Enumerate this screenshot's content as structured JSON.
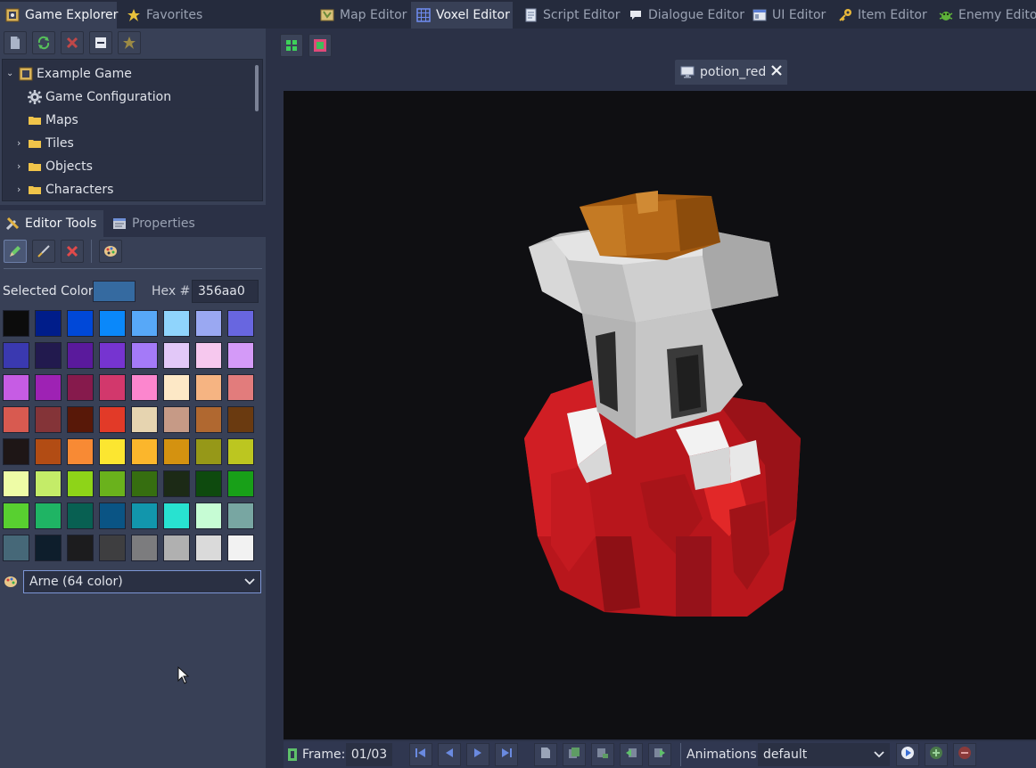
{
  "left_tabs": [
    {
      "label": "Game Explorer",
      "icon": "game-explorer-icon",
      "active": true
    },
    {
      "label": "Favorites",
      "icon": "star-icon",
      "active": false
    }
  ],
  "editor_tabs": [
    {
      "label": "Map Editor",
      "icon": "map-icon",
      "active": false
    },
    {
      "label": "Voxel Editor",
      "icon": "voxel-grid-icon",
      "active": true
    },
    {
      "label": "Script Editor",
      "icon": "script-icon",
      "active": false
    },
    {
      "label": "Dialogue Editor",
      "icon": "dialogue-icon",
      "active": false
    },
    {
      "label": "UI Editor",
      "icon": "ui-window-icon",
      "active": false
    },
    {
      "label": "Item Editor",
      "icon": "key-icon",
      "active": false
    },
    {
      "label": "Enemy Editor",
      "icon": "enemy-bug-icon",
      "active": false
    }
  ],
  "explorer_toolbar": [
    "new-file-icon",
    "refresh-icon",
    "delete-icon",
    "collapse-icon",
    "favorite-star-icon"
  ],
  "tree": [
    {
      "label": "Example Game",
      "icon": "game-icon",
      "depth": 0,
      "arrow": "down"
    },
    {
      "label": "Game Configuration",
      "icon": "gear-icon",
      "depth": 1,
      "arrow": ""
    },
    {
      "label": "Maps",
      "icon": "folder-icon",
      "depth": 1,
      "arrow": ""
    },
    {
      "label": "Tiles",
      "icon": "folder-icon",
      "depth": 1,
      "arrow": "right"
    },
    {
      "label": "Objects",
      "icon": "folder-icon",
      "depth": 1,
      "arrow": "right"
    },
    {
      "label": "Characters",
      "icon": "folder-icon",
      "depth": 1,
      "arrow": "right"
    }
  ],
  "tool_tabs": [
    {
      "label": "Editor Tools",
      "icon": "tools-icon",
      "active": true
    },
    {
      "label": "Properties",
      "icon": "properties-icon",
      "active": false
    }
  ],
  "tools": {
    "selected_color_label": "Selected Color:",
    "selected_color": "#356aa0",
    "hex_label": "Hex #:",
    "hex_value": "356aa0",
    "palette_name": "Arne (64 color)"
  },
  "palette": [
    "#0c0c0c",
    "#001d8a",
    "#0048d8",
    "#0a88fa",
    "#57a8f8",
    "#8fd4fc",
    "#9aa8f2",
    "#6866e0",
    "#3a39b0",
    "#221a4e",
    "#5a1a9c",
    "#7634d0",
    "#a47af8",
    "#e2c8f8",
    "#f6c8ee",
    "#d49af8",
    "#c65ce4",
    "#9e22b4",
    "#861a4c",
    "#d2386c",
    "#fc86ce",
    "#fde8c6",
    "#f6b482",
    "#e27c7c",
    "#d85a50",
    "#843438",
    "#581808",
    "#e23a28",
    "#e6d4b0",
    "#c69a86",
    "#b06830",
    "#6a3a10",
    "#1e1616",
    "#b24c14",
    "#f88a34",
    "#fce630",
    "#fbb62c",
    "#d49210",
    "#969818",
    "#bcc620",
    "#eefca6",
    "#c4ec68",
    "#8ed418",
    "#6ab21c",
    "#366e10",
    "#1c2a16",
    "#0e4a0e",
    "#18a018",
    "#58d030",
    "#1fb464",
    "#086052",
    "#0a5484",
    "#1296ac",
    "#28e2d0",
    "#c6fcd4",
    "#78a6a2",
    "#466878",
    "#0e1e2c",
    "#1c1c1e",
    "#3e3e40",
    "#7c7c7e",
    "#b0b0b0",
    "#dadada",
    "#f2f2f2"
  ],
  "viewport": {
    "file_tab": "potion_red",
    "file_icon": "monitor-icon",
    "close_icon": "close-icon"
  },
  "viewport_toolbar": [
    "grid-toggle-icon",
    "color-square-icon"
  ],
  "animation_bar": {
    "frame_label": "Frame:",
    "frame_value": "01/03",
    "animations_label": "Animations:",
    "animation_value": "default"
  },
  "colors": {
    "accent": "#4e5f8c",
    "panel": "#2b3146",
    "viewport_bg": "#0f0f12"
  }
}
